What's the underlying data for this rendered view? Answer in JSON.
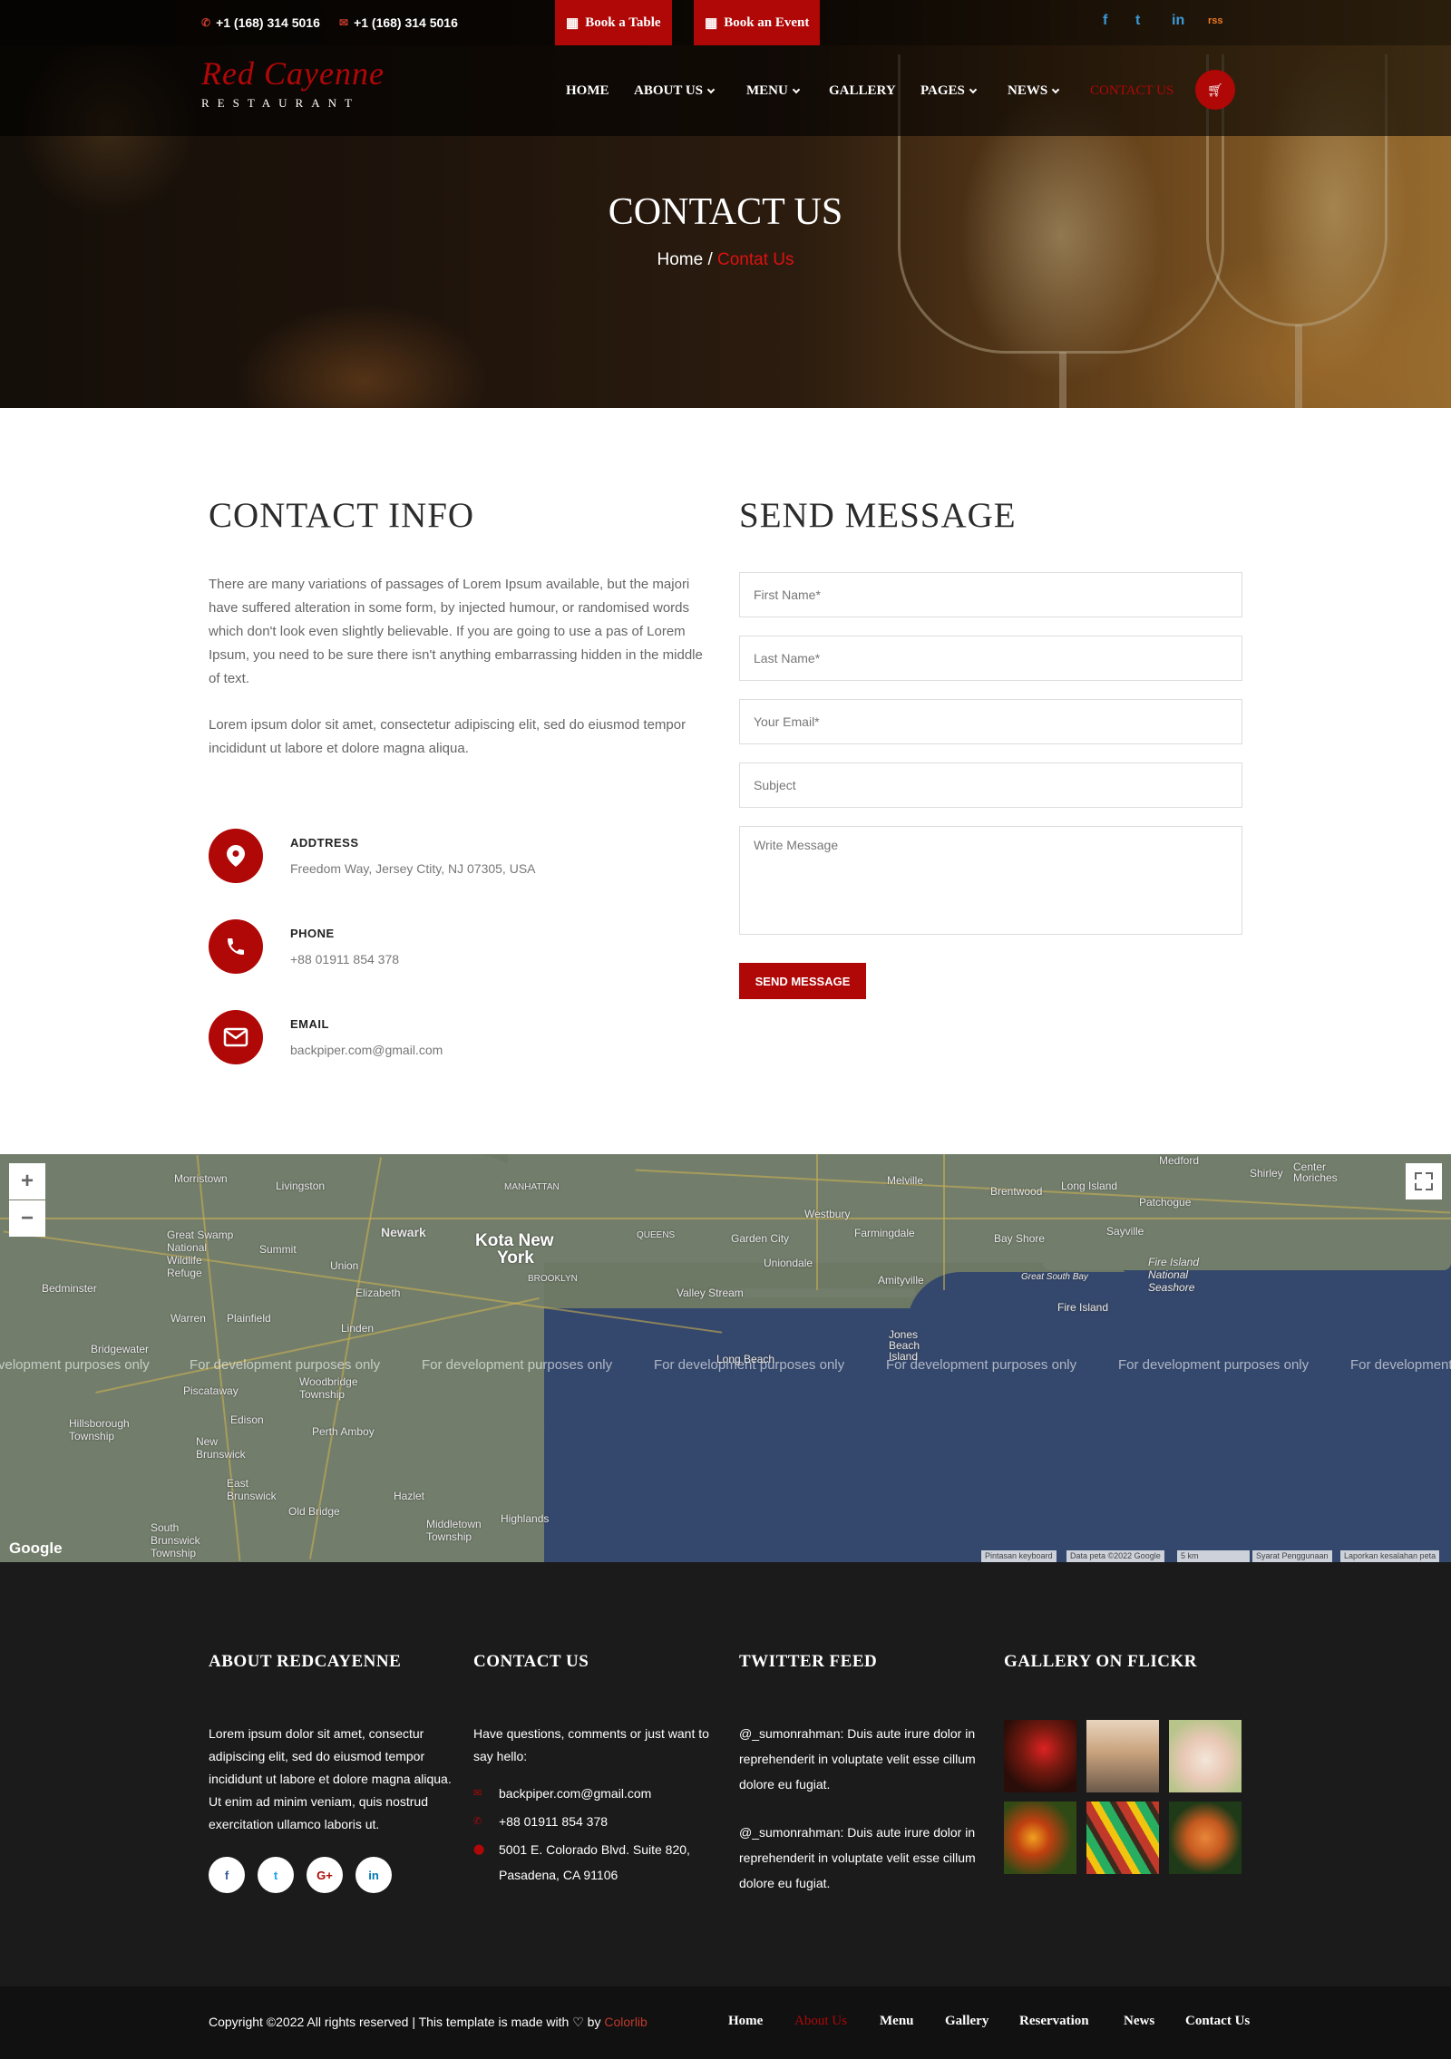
{
  "topbar": {
    "phone1": "+1 (168) 314 5016",
    "phone2": "+1 (168) 314 5016",
    "book_table": "Book a Table",
    "book_event": "Book an Event",
    "social": [
      "f",
      "t",
      "in",
      "rss"
    ]
  },
  "brand": {
    "name": "Red Cayenne",
    "sub": "RESTAURANT"
  },
  "nav": {
    "items": [
      {
        "label": "HOME"
      },
      {
        "label": "ABOUT US"
      },
      {
        "label": "MENU"
      },
      {
        "label": "GALLERY"
      },
      {
        "label": "PAGES"
      },
      {
        "label": "NEWS"
      },
      {
        "label": "CONTACT US"
      }
    ]
  },
  "hero": {
    "title": "CONTACT US",
    "crumb_home": "Home",
    "crumb_sep": "/",
    "crumb_current": "Contat Us"
  },
  "contact_info": {
    "title": "CONTACT INFO",
    "para1": "There are many variations of passages of Lorem Ipsum available, but the majori have suffered alteration in some form, by injected humour, or randomised words which don't look even slightly believable. If you are going to use a pas of Lorem Ipsum, you need to be sure there isn't anything embarrassing hidden in the middle of text.",
    "para2": "Lorem ipsum dolor sit amet, consectetur adipiscing elit, sed do eiusmod tempor incididunt ut labore et dolore magna aliqua.",
    "address_label": "ADDTRESS",
    "address": "Freedom Way, Jersey Ctity, NJ 07305, USA",
    "phone_label": "PHONE",
    "phone": "+88 01911 854 378",
    "email_label": "EMAIL",
    "email": "backpiper.com@gmail.com"
  },
  "form": {
    "title": "SEND MESSAGE",
    "first_name": "First Name*",
    "last_name": "Last Name*",
    "email": "Your Email*",
    "subject": "Subject",
    "message": "Write Message",
    "submit": "SEND MESSAGE"
  },
  "map": {
    "labels": {
      "morristown": "Morristown",
      "livingston": "Livingston",
      "manhattan": "MANHATTAN",
      "newark": "Newark",
      "kota_new_york_1": "Kota New",
      "kota_new_york_2": "York",
      "great_swamp": "Great Swamp National Wildlife Refuge",
      "summit": "Summit",
      "union": "Union",
      "elizabeth": "Elizabeth",
      "bedminster": "Bedminster",
      "warren": "Warren",
      "plainfield": "Plainfield",
      "linden": "Linden",
      "bridgewater": "Bridgewater",
      "piscataway": "Piscataway",
      "woodbridge": "Woodbridge Township",
      "perth_amboy": "Perth Amboy",
      "edison": "Edison",
      "hillsborough": "Hillsborough Township",
      "new_brunswick": "New Brunswick",
      "east_brunswick": "East Brunswick",
      "old_bridge": "Old Bridge",
      "hazlet": "Hazlet",
      "middletown": "Middletown Township",
      "highlands": "Highlands",
      "south_brunswick": "South Brunswick Township",
      "brooklyn": "BROOKLYN",
      "queens": "QUEENS",
      "valley_stream": "Valley Stream",
      "long_beach": "Long Beach",
      "garden_city": "Garden City",
      "uniondale": "Uniondale",
      "westbury": "Westbury",
      "farmingdale": "Farmingdale",
      "amityville": "Amityville",
      "jones_beach": "Jones Beach Island",
      "melville": "Melville",
      "brentwood": "Brentwood",
      "bay_shore": "Bay Shore",
      "long_island": "Long Island",
      "patchogue": "Patchogue",
      "sayville": "Sayville",
      "fire_island": "Fire Island",
      "fire_island_ns": "Fire Island National Seashore",
      "great_south_bay": "Great South Bay",
      "medford": "Medford",
      "shirley": "Shirley",
      "center_moriches": "Center Moriches"
    },
    "dev_text": "For development purposes only",
    "dev_text_left": "velopment purposes only",
    "dev_text_right": "For development",
    "zoom_in": "+",
    "zoom_out": "−",
    "google": "Google",
    "attr1": "Pintasan keyboard",
    "attr2": "Data peta ©2022 Google",
    "attr3": "5 km",
    "attr4": "Syarat Penggunaan",
    "attr5": "Laporkan kesalahan peta"
  },
  "footer": {
    "about_title": "ABOUT REDCAYENNE",
    "about_text": "Lorem ipsum dolor sit amet, consectur adipiscing elit, sed do eiusmod tempor incididunt ut labore et dolore magna aliqua. Ut enim ad minim veniam, quis nostrud exercitation ullamco laboris ut.",
    "social": [
      "f",
      "t",
      "G+",
      "in"
    ],
    "contact_title": "CONTACT US",
    "contact_intro": "Have questions, comments or just want to say hello:",
    "contact_email": "backpiper.com@gmail.com",
    "contact_phone": "+88 01911 854 378",
    "contact_address1": "5001 E. Colorado Blvd. Suite 820,",
    "contact_address2": "Pasadena, CA 91106",
    "twitter_title": "TWITTER FEED",
    "tweet1": "@_sumonrahman: Duis aute irure dolor in reprehenderit in voluptate velit esse cillum dolore eu fugiat.",
    "tweet2": "@_sumonrahman: Duis aute irure dolor in reprehenderit in voluptate velit esse cillum dolore eu fugiat.",
    "gallery_title": "GALLERY ON FLICKR"
  },
  "bottom": {
    "copy_prefix": "Copyright ©2022 All rights reserved | This template is made with",
    "heart": "♡",
    "by": "by",
    "brand": "Colorlib",
    "links": [
      "Home",
      "About Us",
      "Menu",
      "Gallery",
      "Reservation",
      "News",
      "Contact Us"
    ]
  },
  "colors": {
    "accent": "#b00707",
    "footer_bg": "#1b1b1b",
    "bottom_bg": "#111111"
  }
}
